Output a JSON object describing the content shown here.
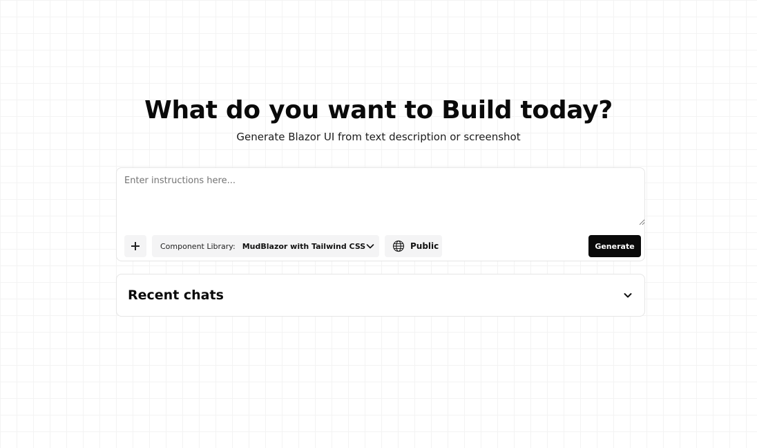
{
  "hero": {
    "title": "What do you want to Build today?",
    "subtitle": "Generate Blazor UI from text description or screenshot"
  },
  "prompt": {
    "placeholder": "Enter instructions here...",
    "value": ""
  },
  "toolbar": {
    "attach_icon": "plus-icon",
    "library_prefix": "Component Library:",
    "library_value": "MudBlazor with Tailwind CSS",
    "library_icon": "chevron-down-icon",
    "visibility_icon": "globe-icon",
    "visibility_label": "Public",
    "generate_label": "Generate"
  },
  "recent": {
    "title": "Recent chats",
    "icon": "chevron-down-icon"
  },
  "colors": {
    "primary_button": "#0a0a0a",
    "secondary_button": "#f4f4f5",
    "border": "#e5e5e5"
  }
}
